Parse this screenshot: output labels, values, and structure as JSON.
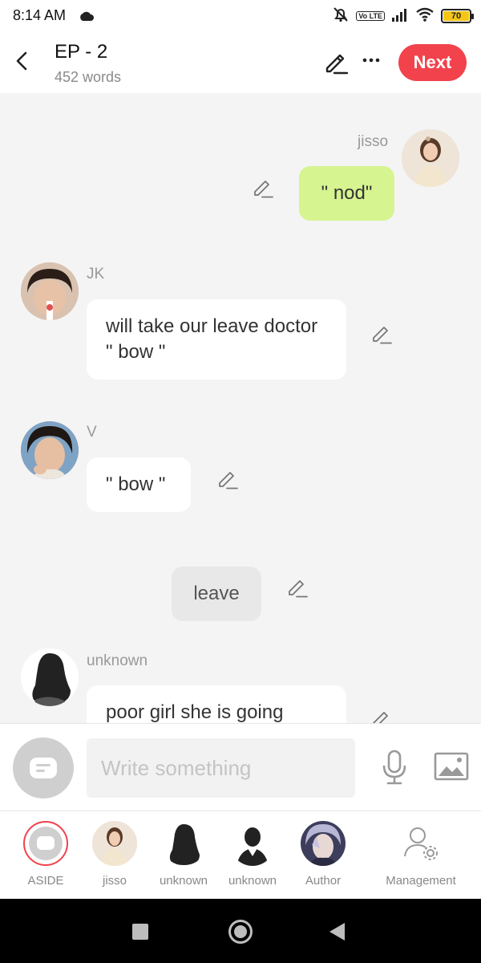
{
  "status": {
    "time": "8:14 AM",
    "battery": "70",
    "lte": "Vo LTE"
  },
  "header": {
    "title": "EP - 2",
    "words": "452 words",
    "next_label": "Next"
  },
  "messages": [
    {
      "speaker": "jisso",
      "text": "\" nod\"",
      "style": "green",
      "side": "right"
    },
    {
      "speaker": "JK",
      "text": "will take our leave doctor \" bow \"",
      "style": "white",
      "side": "left"
    },
    {
      "speaker": "V",
      "text": "\" bow \"",
      "style": "white",
      "side": "left"
    },
    {
      "speaker": "",
      "text": "leave",
      "style": "aside",
      "side": "center"
    },
    {
      "speaker": "unknown",
      "text": "poor girl she is going",
      "style": "white",
      "side": "left"
    }
  ],
  "input": {
    "placeholder": "Write something"
  },
  "roles": [
    {
      "label": "ASIDE",
      "selected": true
    },
    {
      "label": "jisso"
    },
    {
      "label": "unknown"
    },
    {
      "label": "unknown"
    },
    {
      "label": "Author"
    },
    {
      "label": "Management"
    }
  ],
  "colors": {
    "accent": "#f2424c",
    "green_bubble": "#d6f490",
    "background": "#f4f4f4"
  }
}
